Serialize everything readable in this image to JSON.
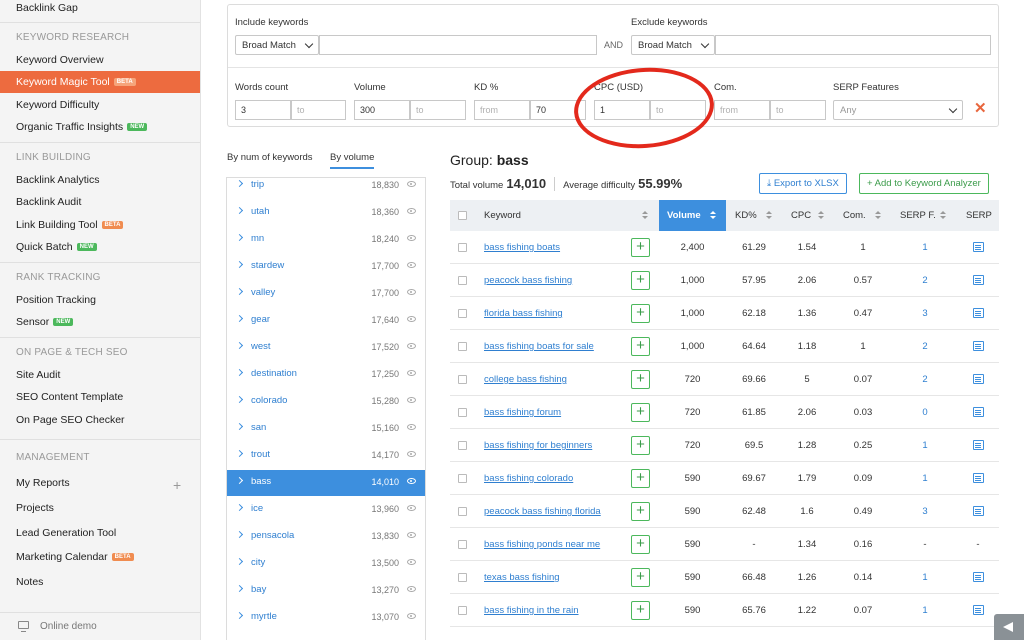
{
  "sidebar": {
    "top_item": "Backlink Gap",
    "sections": [
      {
        "heading": "KEYWORD RESEARCH",
        "items": [
          {
            "label": "Keyword Overview"
          },
          {
            "label": "Keyword Magic Tool",
            "badge": "BETA",
            "active": true
          },
          {
            "label": "Keyword Difficulty"
          },
          {
            "label": "Organic Traffic Insights",
            "badge": "NEW"
          }
        ]
      },
      {
        "heading": "LINK BUILDING",
        "items": [
          {
            "label": "Backlink Analytics"
          },
          {
            "label": "Backlink Audit"
          },
          {
            "label": "Link Building Tool",
            "badge": "BETA"
          },
          {
            "label": "Quick Batch",
            "badge": "NEW"
          }
        ]
      },
      {
        "heading": "RANK TRACKING",
        "items": [
          {
            "label": "Position Tracking"
          },
          {
            "label": "Sensor",
            "badge": "NEW"
          }
        ]
      },
      {
        "heading": "ON PAGE & TECH SEO",
        "items": [
          {
            "label": "Site Audit"
          },
          {
            "label": "SEO Content Template"
          },
          {
            "label": "On Page SEO Checker"
          }
        ]
      },
      {
        "heading": "MANAGEMENT",
        "items": [
          {
            "label": "My Reports"
          },
          {
            "label": "Projects"
          },
          {
            "label": "Lead Generation Tool"
          },
          {
            "label": "Marketing Calendar",
            "badge": "BETA"
          },
          {
            "label": "Notes"
          }
        ]
      }
    ],
    "footer": "Online demo",
    "plus": "+"
  },
  "filters": {
    "include_label": "Include keywords",
    "include_match": "Broad Match",
    "and_label": "AND",
    "exclude_label": "Exclude keywords",
    "exclude_match": "Broad Match",
    "words_count": {
      "label": "Words count",
      "from": "3",
      "to_placeholder": "to"
    },
    "volume": {
      "label": "Volume",
      "from": "300",
      "to_placeholder": "to"
    },
    "kd": {
      "label": "KD %",
      "from_placeholder": "from",
      "to": "70"
    },
    "cpc": {
      "label": "CPC (USD)",
      "from": "1",
      "to_placeholder": "to"
    },
    "com": {
      "label": "Com.",
      "from_placeholder": "from",
      "to_placeholder": "to"
    },
    "serp": {
      "label": "SERP Features",
      "value": "Any"
    },
    "clear": "✕"
  },
  "tabs": [
    "By num of keywords",
    "By volume"
  ],
  "word_list": [
    {
      "word": "trip",
      "volume": "18,830"
    },
    {
      "word": "utah",
      "volume": "18,360"
    },
    {
      "word": "mn",
      "volume": "18,240"
    },
    {
      "word": "stardew",
      "volume": "17,700"
    },
    {
      "word": "valley",
      "volume": "17,700"
    },
    {
      "word": "gear",
      "volume": "17,640"
    },
    {
      "word": "west",
      "volume": "17,520"
    },
    {
      "word": "destination",
      "volume": "17,250"
    },
    {
      "word": "colorado",
      "volume": "15,280"
    },
    {
      "word": "san",
      "volume": "15,160"
    },
    {
      "word": "trout",
      "volume": "14,170"
    },
    {
      "word": "bass",
      "volume": "14,010",
      "selected": true
    },
    {
      "word": "ice",
      "volume": "13,960"
    },
    {
      "word": "pensacola",
      "volume": "13,830"
    },
    {
      "word": "city",
      "volume": "13,500"
    },
    {
      "word": "bay",
      "volume": "13,270"
    },
    {
      "word": "myrtle",
      "volume": "13,070"
    }
  ],
  "group": {
    "label": "Group:",
    "name": "bass",
    "total_label": "Total volume",
    "total_value": "14,010",
    "difficulty_label": "Average difficulty",
    "difficulty_value": "55.99%"
  },
  "buttons": {
    "export": "Export to XLSX",
    "add": "Add to Keyword Analyzer"
  },
  "table": {
    "headers": {
      "keyword": "Keyword",
      "volume": "Volume",
      "kd": "KD%",
      "cpc": "CPC",
      "com": "Com.",
      "serpf": "SERP F.",
      "serp": "SERP"
    },
    "rows": [
      {
        "keyword": "bass fishing boats",
        "volume": "2,400",
        "kd": "61.29",
        "cpc": "1.54",
        "com": "1",
        "serpf": "1"
      },
      {
        "keyword": "peacock bass fishing",
        "volume": "1,000",
        "kd": "57.95",
        "cpc": "2.06",
        "com": "0.57",
        "serpf": "2"
      },
      {
        "keyword": "florida bass fishing",
        "volume": "1,000",
        "kd": "62.18",
        "cpc": "1.36",
        "com": "0.47",
        "serpf": "3"
      },
      {
        "keyword": "bass fishing boats for sale",
        "volume": "1,000",
        "kd": "64.64",
        "cpc": "1.18",
        "com": "1",
        "serpf": "2"
      },
      {
        "keyword": "college bass fishing",
        "volume": "720",
        "kd": "69.66",
        "cpc": "5",
        "com": "0.07",
        "serpf": "2"
      },
      {
        "keyword": "bass fishing forum",
        "volume": "720",
        "kd": "61.85",
        "cpc": "2.06",
        "com": "0.03",
        "serpf": "0"
      },
      {
        "keyword": "bass fishing for beginners",
        "volume": "720",
        "kd": "69.5",
        "cpc": "1.28",
        "com": "0.25",
        "serpf": "1"
      },
      {
        "keyword": "bass fishing colorado",
        "volume": "590",
        "kd": "69.67",
        "cpc": "1.79",
        "com": "0.09",
        "serpf": "1"
      },
      {
        "keyword": "peacock bass fishing florida",
        "volume": "590",
        "kd": "62.48",
        "cpc": "1.6",
        "com": "0.49",
        "serpf": "3"
      },
      {
        "keyword": "bass fishing ponds near me",
        "volume": "590",
        "kd": "-",
        "cpc": "1.34",
        "com": "0.16",
        "serpf": "-",
        "serp": "-"
      },
      {
        "keyword": "texas bass fishing",
        "volume": "590",
        "kd": "66.48",
        "cpc": "1.26",
        "com": "0.14",
        "serpf": "1"
      },
      {
        "keyword": "bass fishing in the rain",
        "volume": "590",
        "kd": "65.76",
        "cpc": "1.22",
        "com": "0.07",
        "serpf": "1"
      }
    ]
  },
  "colors": {
    "accent": "#ed6b3f",
    "primary": "#3d8fde",
    "green": "#4cb85c",
    "annotation": "#e3291c"
  }
}
